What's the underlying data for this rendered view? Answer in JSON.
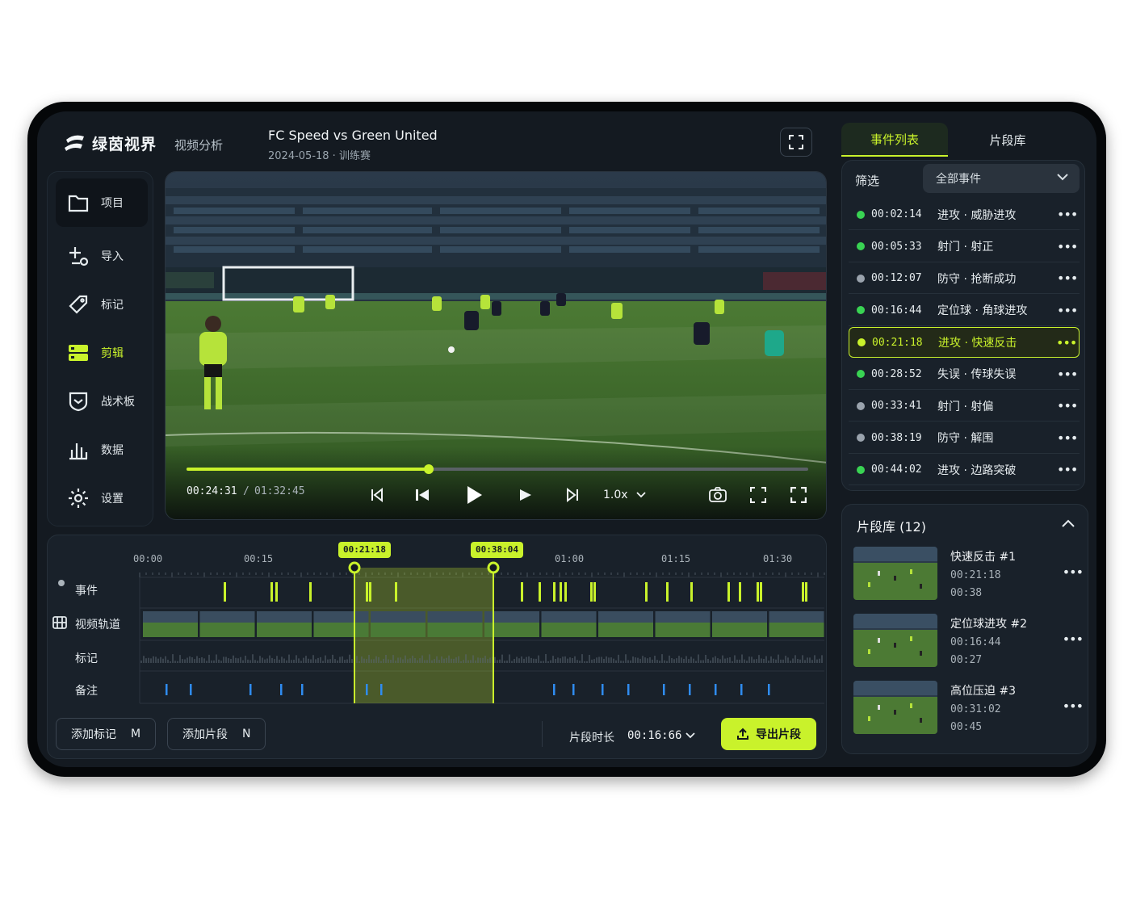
{
  "app": {
    "logo_text": "绿茵视界",
    "module": "视频分析"
  },
  "match": {
    "title": "FC Speed vs Green United",
    "subtitle": "2024-05-18 · 训练赛"
  },
  "sidebar": {
    "items": [
      {
        "label": "项目",
        "icon": "folder-icon"
      },
      {
        "label": "导入",
        "icon": "import-icon"
      },
      {
        "label": "标记",
        "icon": "tag-icon"
      },
      {
        "label": "剪辑",
        "icon": "clip-icon"
      },
      {
        "label": "战术板",
        "icon": "tactics-board-icon"
      },
      {
        "label": "数据",
        "icon": "bar-chart-icon"
      },
      {
        "label": "设置",
        "icon": "gear-icon"
      }
    ],
    "active_index": 3
  },
  "player": {
    "current_time": "00:24:31",
    "separator": "/",
    "total_time": "01:32:45",
    "progress": 0.39,
    "speed": "1.0x"
  },
  "tabs": [
    {
      "label": "事件列表",
      "active": true
    },
    {
      "label": "片段库",
      "active": false
    }
  ],
  "filter": {
    "label": "筛选",
    "value": "全部事件"
  },
  "events": [
    {
      "time": "00:02:14",
      "label": "进攻 · 威胁进攻",
      "dot": "#39d353",
      "highlight": false
    },
    {
      "time": "00:05:33",
      "label": "射门 · 射正",
      "dot": "#39d353",
      "highlight": false
    },
    {
      "time": "00:12:07",
      "label": "防守 · 抢断成功",
      "dot": "#9aa3ad",
      "highlight": false
    },
    {
      "time": "00:16:44",
      "label": "定位球 · 角球进攻",
      "dot": "#39d353",
      "highlight": false
    },
    {
      "time": "00:21:18",
      "label": "进攻 · 快速反击",
      "dot": "#c9f22b",
      "highlight": true
    },
    {
      "time": "00:28:52",
      "label": "失误 · 传球失误",
      "dot": "#39d353",
      "highlight": false
    },
    {
      "time": "00:33:41",
      "label": "射门 · 射偏",
      "dot": "#9aa3ad",
      "highlight": false
    },
    {
      "time": "00:38:19",
      "label": "防守 · 解围",
      "dot": "#9aa3ad",
      "highlight": false
    },
    {
      "time": "00:44:02",
      "label": "进攻 · 边路突破",
      "dot": "#39d353",
      "highlight": false
    }
  ],
  "clip_library": {
    "title": "片段库 (12)",
    "clips": [
      {
        "name": "快速反击 #1",
        "start": "00:21:18",
        "duration": "00:38"
      },
      {
        "name": "定位球进攻 #2",
        "start": "00:16:44",
        "duration": "00:27"
      },
      {
        "name": "高位压迫 #3",
        "start": "00:31:02",
        "duration": "00:45"
      }
    ]
  },
  "timeline": {
    "ruler": [
      "00:00",
      "00:15",
      "01:00",
      "01:15",
      "01:30"
    ],
    "in_marker": "00:21:18",
    "out_marker": "00:38:04",
    "tracks": [
      {
        "label": "事件",
        "icon": "dot-icon"
      },
      {
        "label": "视频轨道",
        "icon": "film-icon"
      },
      {
        "label": "标记",
        "icon": ""
      },
      {
        "label": "备注",
        "icon": ""
      }
    ]
  },
  "actions": {
    "add_marker": "添加标记",
    "add_marker_key": "M",
    "add_clip": "添加片段",
    "add_clip_key": "N",
    "clip_length_label": "片段时长",
    "clip_length": "00:16:66",
    "export": "导出片段"
  },
  "colors": {
    "accent": "#c9f22b",
    "panel": "#19212a",
    "bg": "#141a21",
    "note_marker": "#2f8cf0"
  }
}
